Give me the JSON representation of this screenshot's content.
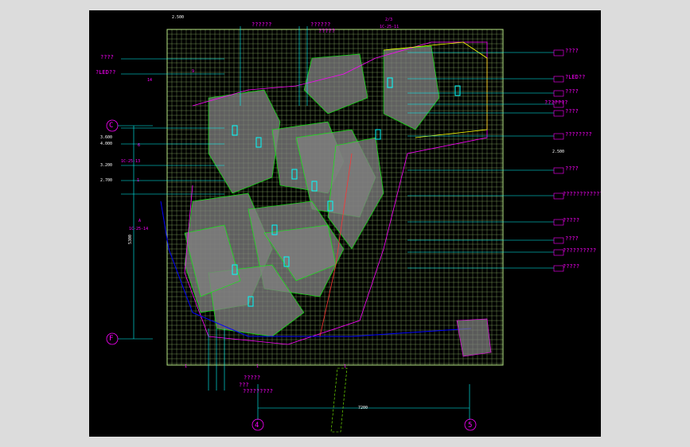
{
  "drawing": {
    "colors": {
      "background": "#000000",
      "frame": "#dcdcdc",
      "grid": "#b8e986",
      "leader": "#00ffff",
      "text": "#ff00ff",
      "fill": "#808080",
      "accent": "#ffff00"
    },
    "right_labels": [
      "????",
      "?LED??",
      "????",
      "???????",
      "????",
      "????????",
      "????",
      "????????????",
      "?????",
      "????",
      "??????????",
      "?????"
    ],
    "left_labels": [
      "????",
      "?LED??"
    ],
    "top_labels": [
      "??????",
      "??????",
      "?????"
    ],
    "bottom_labels": [
      "?????",
      "???",
      "?????????"
    ],
    "grid_markers": {
      "left_top": "C",
      "left_bottom": "F",
      "bottom_left": "4",
      "bottom_right": "5"
    },
    "dims": {
      "d1": "3.600",
      "d2": "4.000",
      "d3": "3.200",
      "d4": "2.700",
      "top": "2.500",
      "right1": "2.500",
      "bottom_span": "7200",
      "vertical": "5300"
    },
    "small_tags": {
      "t1": "2/3",
      "t2": "14",
      "t3": "9",
      "t4": "6",
      "t5": "A",
      "t6": "1",
      "b1": "1",
      "b2": "1",
      "b3": "1",
      "code1": "1C-25-11",
      "code2": "1C-25-13",
      "code3": "1C-25-14"
    }
  }
}
